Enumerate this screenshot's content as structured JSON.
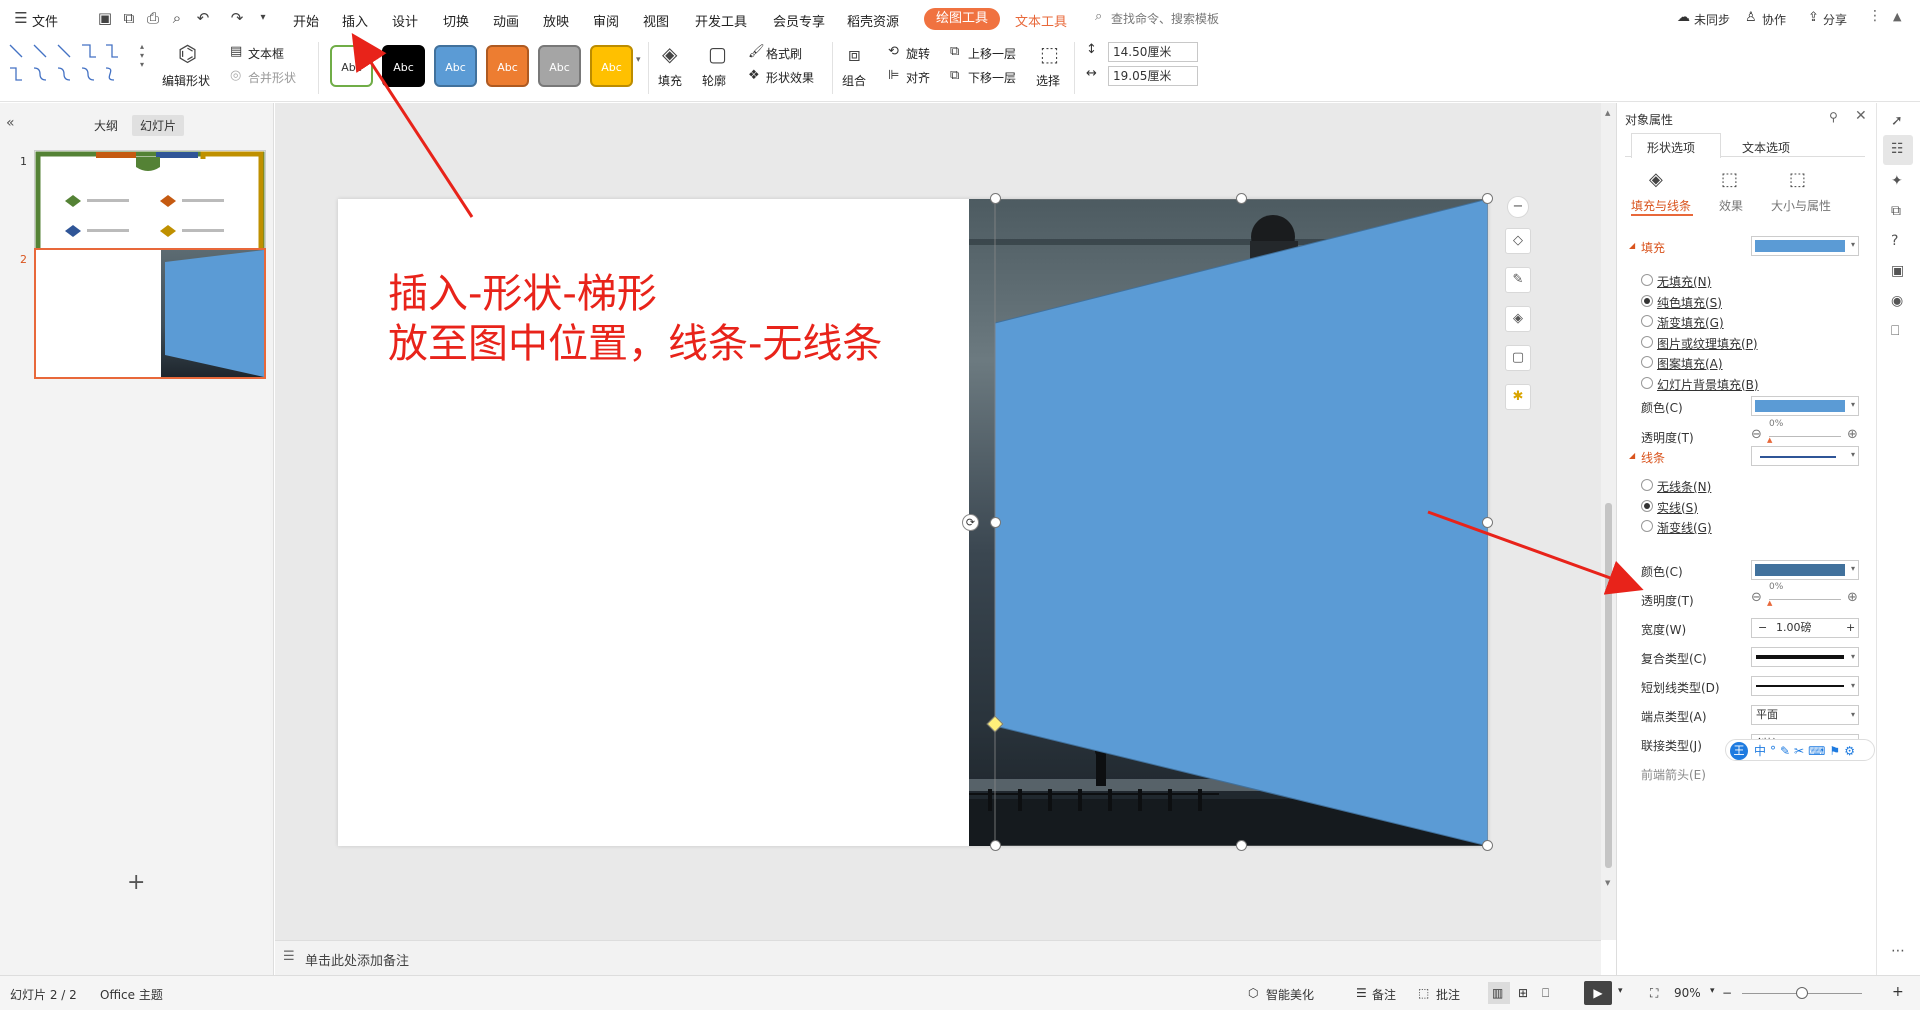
{
  "menubar": {
    "file": "文件",
    "tabs": [
      "开始",
      "插入",
      "设计",
      "切换",
      "动画",
      "放映",
      "审阅",
      "视图",
      "开发工具",
      "会员专享",
      "稻壳资源"
    ],
    "drawing_tools": "绘图工具",
    "text_tools": "文本工具",
    "search_placeholder": "查找命令、搜索模板",
    "unsynced": "未同步",
    "collaborate": "协作",
    "share": "分享"
  },
  "ribbon": {
    "edit_shape": "编辑形状",
    "text_box": "文本框",
    "merge_shape": "合并形状",
    "styles": [
      {
        "label": "Abc",
        "bg": "#ffffff",
        "fg": "#333333",
        "border": "#70ad47"
      },
      {
        "label": "Abc",
        "bg": "#000000",
        "fg": "#ffffff",
        "border": "#000000"
      },
      {
        "label": "Abc",
        "bg": "#5b9bd5",
        "fg": "#ffffff",
        "border": "#41719c"
      },
      {
        "label": "Abc",
        "bg": "#ed7d31",
        "fg": "#ffffff",
        "border": "#ae5a21"
      },
      {
        "label": "Abc",
        "bg": "#a5a5a5",
        "fg": "#ffffff",
        "border": "#787878"
      },
      {
        "label": "Abc",
        "bg": "#ffc000",
        "fg": "#ffffff",
        "border": "#bc8c00"
      }
    ],
    "fill": "填充",
    "outline": "轮廓",
    "format_painter": "格式刷",
    "shape_effects": "形状效果",
    "rotate": "旋转",
    "bring_forward": "上移一层",
    "group": "组合",
    "align": "对齐",
    "send_backward": "下移一层",
    "select": "选择",
    "height_value": "14.50厘米",
    "width_value": "19.05厘米"
  },
  "left_panel": {
    "tab_outline": "大纲",
    "tab_slides": "幻灯片",
    "slide_numbers": [
      "1",
      "2"
    ],
    "add_slide": "+"
  },
  "slide": {
    "annotation_line1": "插入-形状-梯形",
    "annotation_line2": "放至图中位置，线条-无线条",
    "shape_color": "#5b9bd5"
  },
  "notes": {
    "placeholder": "单击此处添加备注"
  },
  "right_panel": {
    "title": "对象属性",
    "tab_shape": "形状选项",
    "tab_text": "文本选项",
    "sub_fill_line": "填充与线条",
    "sub_effects": "效果",
    "sub_size": "大小与属性",
    "fill_section": "填充",
    "fill_options": [
      "无填充(N)",
      "纯色填充(S)",
      "渐变填充(G)",
      "图片或纹理填充(P)",
      "图案填充(A)",
      "幻灯片背景填充(B)"
    ],
    "fill_selected": 1,
    "color_label": "颜色(C)",
    "transparency_label": "透明度(T)",
    "transparency_value": "0%",
    "fill_color": "#5b9bd5",
    "line_section": "线条",
    "line_options": [
      "无线条(N)",
      "实线(S)",
      "渐变线(G)"
    ],
    "line_selected": 1,
    "line_color": "#41719c",
    "line_transparency_value": "0%",
    "width_label": "宽度(W)",
    "width_value": "1.00磅",
    "compound_label": "复合类型(C)",
    "dash_label": "短划线类型(D)",
    "cap_label": "端点类型(A)",
    "cap_value": "平面",
    "join_label": "联接类型(J)",
    "join_value": "斜接",
    "arrow_label": "前端箭头(E)"
  },
  "statusbar": {
    "slide_info": "幻灯片 2 / 2",
    "theme": "Office 主题",
    "smart_beautify": "智能美化",
    "notes": "备注",
    "comments": "批注",
    "zoom": "90%"
  }
}
